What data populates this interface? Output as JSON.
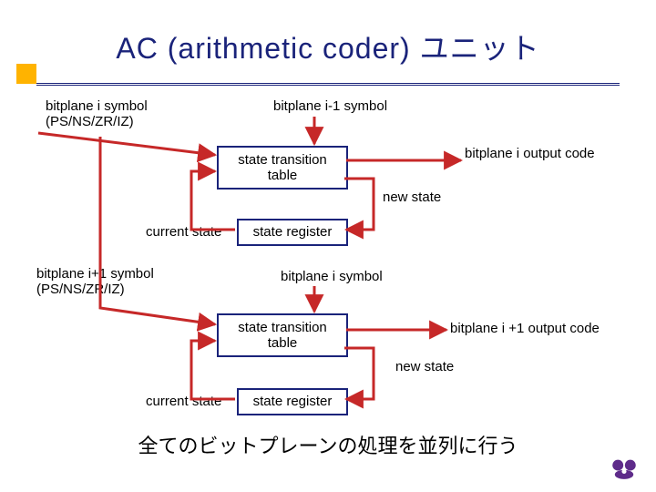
{
  "title": "AC (arithmetic coder) ユニット",
  "stage1": {
    "input_label_line1": "bitplane i symbol",
    "input_label_line2": "(PS/NS/ZR/IZ)",
    "top_symbol_label": "bitplane i-1 symbol",
    "stt_label": "state transition\ntable",
    "output_label": "bitplane i output code",
    "newstate_label": "new state",
    "sr_label": "state register",
    "current_label": "current state"
  },
  "stage2": {
    "input_label_line1": "bitplane i+1 symbol",
    "input_label_line2": "(PS/NS/ZR/IZ)",
    "top_symbol_label": "bitplane i symbol",
    "stt_label": "state transition\ntable",
    "output_label": "bitplane i +1 output code",
    "newstate_label": "new state",
    "sr_label": "state register",
    "current_label": "current state"
  },
  "footer": "全てのビットプレーンの処理を並列に行う"
}
